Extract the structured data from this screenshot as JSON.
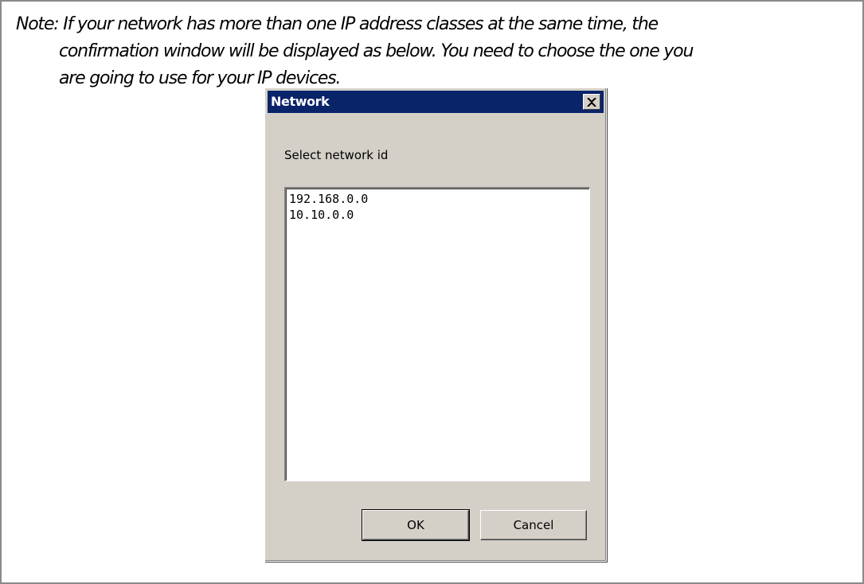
{
  "note": {
    "line1": "Note: If your network has more than one IP address classes at the same time, the",
    "line2": "confirmation window will be displayed as below. You need to choose the one you",
    "line3": "are going to use for your IP devices."
  },
  "dialog": {
    "title": "Network",
    "close_icon": "close-icon",
    "prompt": "Select network id",
    "list_items": [
      "192.168.0.0",
      "10.10.0.0"
    ],
    "ok_label": "OK",
    "cancel_label": "Cancel"
  },
  "colors": {
    "titlebar": "#0a246a",
    "dialog_bg": "#d4d0c8"
  }
}
